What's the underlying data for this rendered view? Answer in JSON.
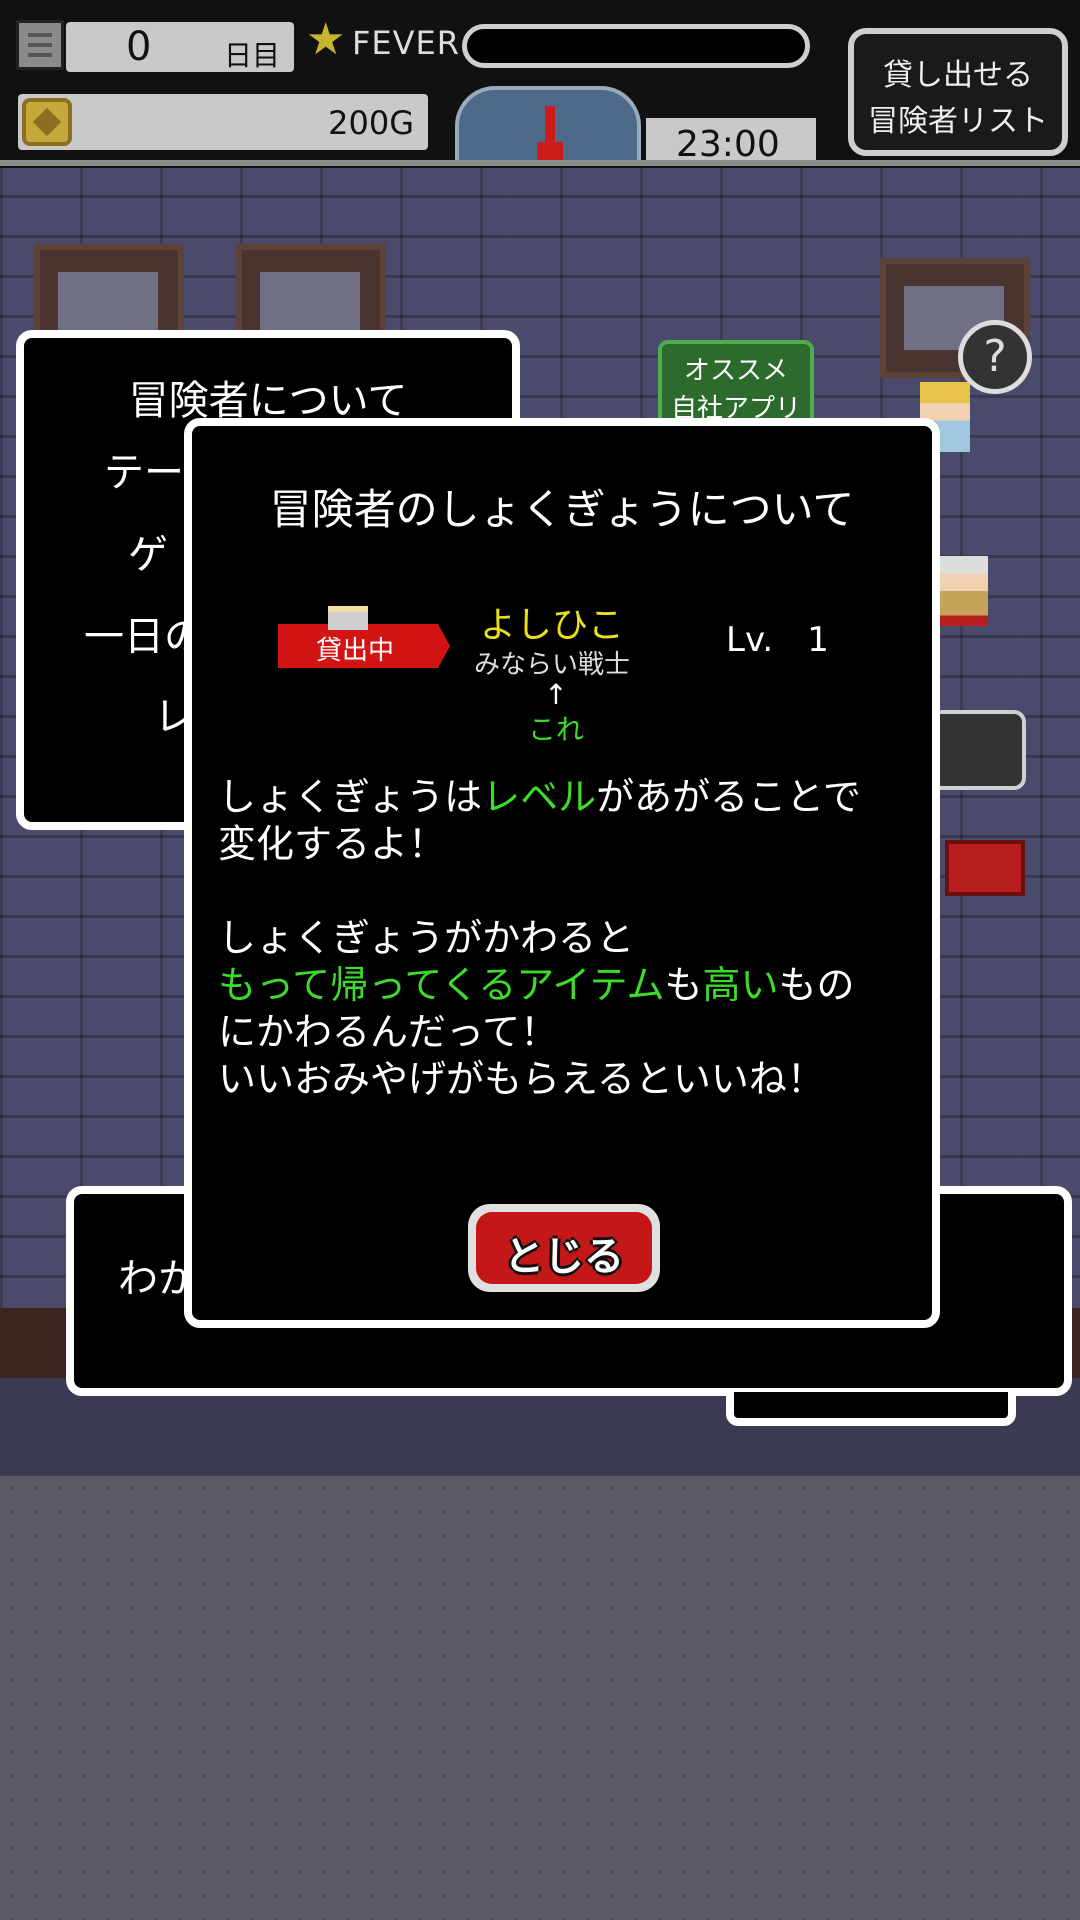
{
  "hud": {
    "day_count": "0",
    "day_unit": "日目",
    "fever_label": "FEVER",
    "fever_level": 0,
    "gold": "200G",
    "time": "23:00",
    "rent_button_line1": "貸し出せる",
    "rent_button_line2": "冒険者リスト",
    "icons": [
      "menu-icon",
      "star-icon",
      "coin-icon",
      "clock-icon"
    ]
  },
  "scene": {
    "promo_line1": "オススメ",
    "promo_line2": "自社アプリ",
    "help_mark": "?"
  },
  "back_dialog": {
    "title": "冒険者について",
    "line2": "テー",
    "line3": "ゲ",
    "line4": "一日の",
    "line5": "レ"
  },
  "bottom_dialog": {
    "text": "わか"
  },
  "main_dialog": {
    "title": "冒険者のしょくぎょうについて",
    "rental_badge": "貸出中",
    "adventurer_name": "よしひこ",
    "adventurer_job": "みならい戦士",
    "level": "Lv.　1",
    "arrow": "↑",
    "this_label": "これ",
    "para1": {
      "line1_a": "しょくぎょうは",
      "line1_hl": "レベル",
      "line1_b": "があがることで",
      "line2": "変化するよ！"
    },
    "para2": {
      "line1": "しょくぎょうがかわると",
      "line2_hl1": "もって帰ってくるアイテム",
      "line2_a": "も",
      "line2_hl2": "高い",
      "line2_b": "もの",
      "line3": "にかわるんだって！",
      "line4": "いいおみやげがもらえるといいね！"
    },
    "close_button": "とじる"
  },
  "colors": {
    "highlight_green": "#3ddb2a",
    "name_yellow": "#e8e01a",
    "badge_red": "#d21414",
    "button_red": "#c41818"
  }
}
